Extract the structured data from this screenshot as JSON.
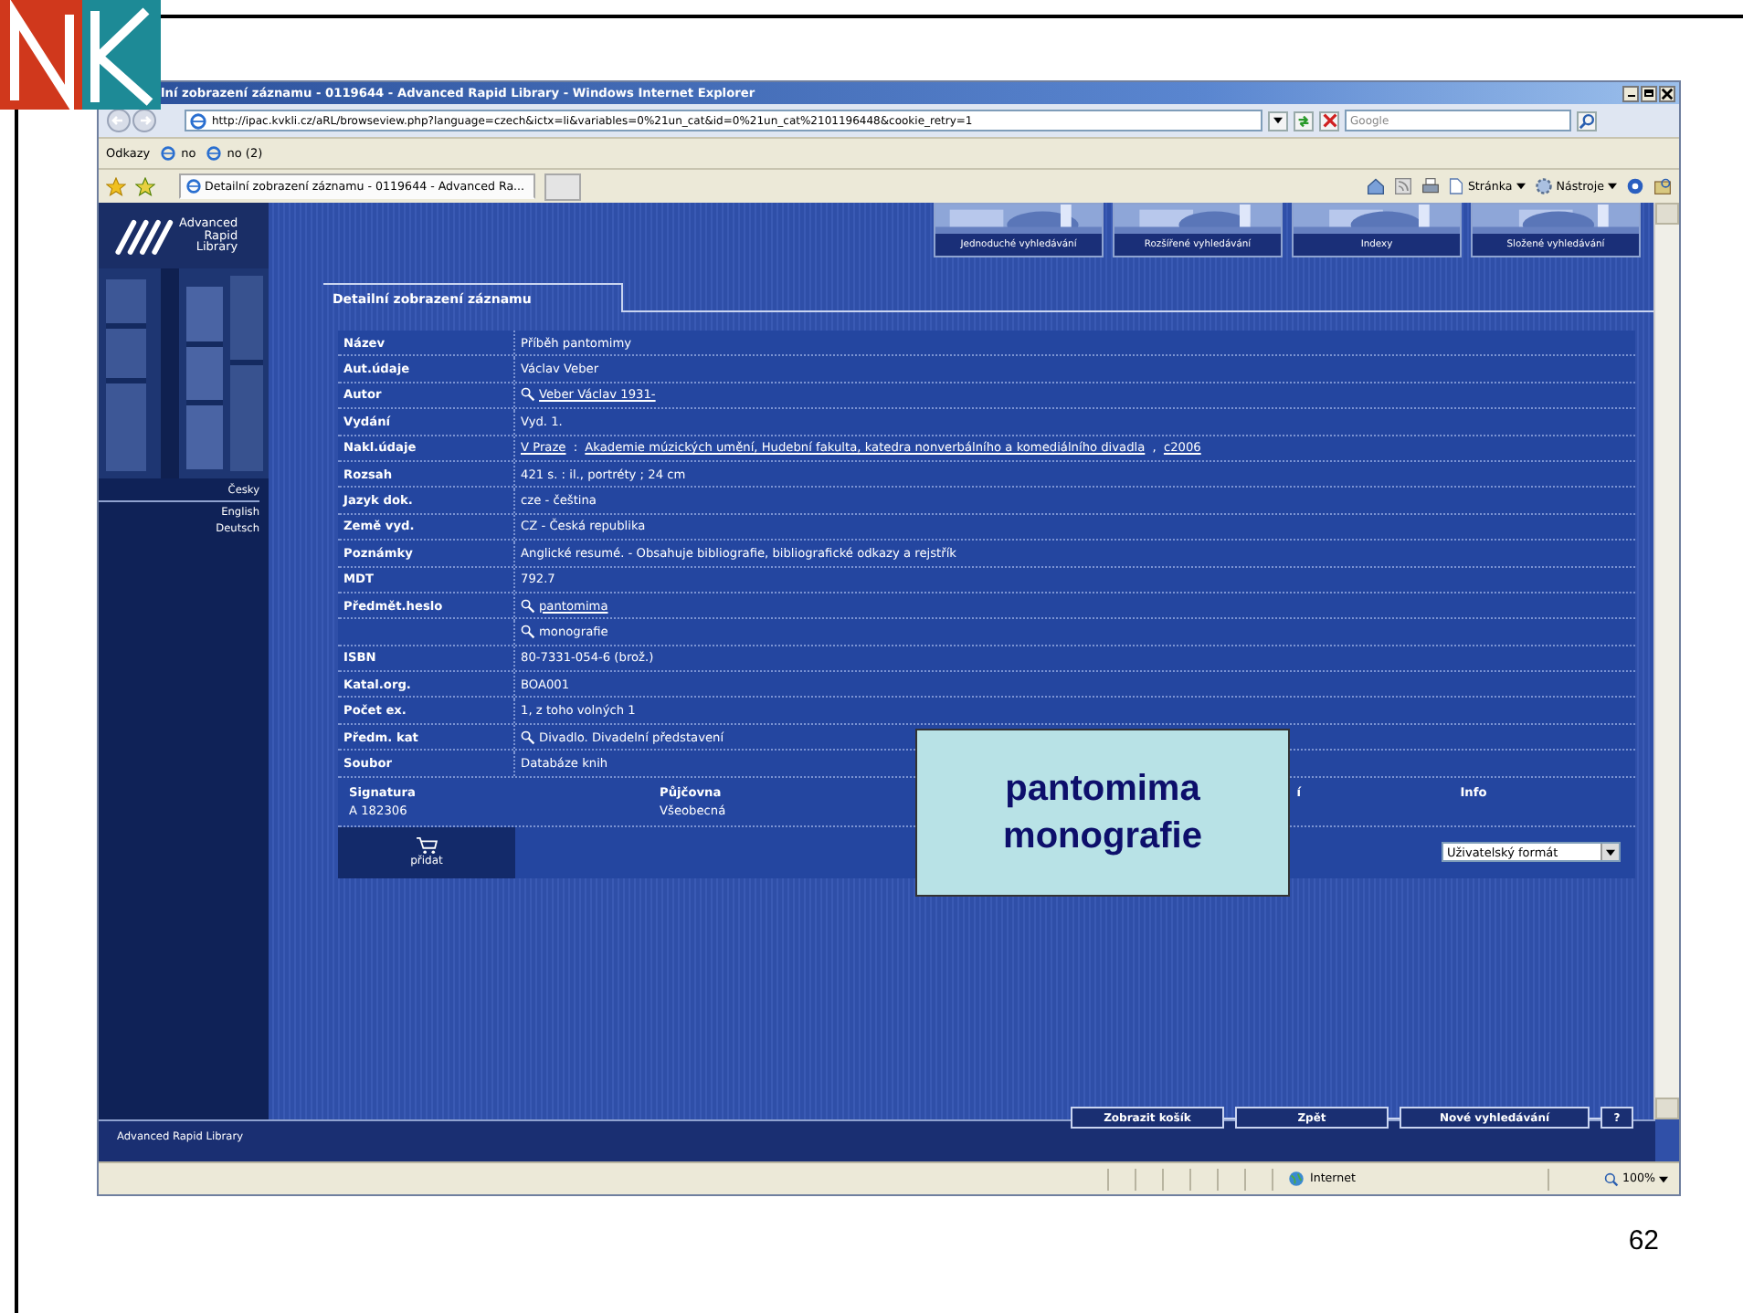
{
  "slide": {
    "page_number": "62"
  },
  "browser": {
    "title": "lní zobrazení záznamu - 0119644 - Advanced Rapid Library - Windows Internet Explorer",
    "address": "http://ipac.kvkli.cz/aRL/browseview.php?language=czech&ictx=li&variables=0%21un_cat&id=0%21un_cat%2101196448&cookie_retry=1",
    "search_placeholder": "Google",
    "links_label": "Odkazy",
    "links": [
      "no",
      "no (2)"
    ],
    "tabs": [
      {
        "label": "Detailní zobrazení záznamu - 0119644 - Advanced Ra...",
        "selected": true
      }
    ],
    "commands": [
      "Stránka",
      "Nástroje"
    ],
    "status": {
      "zone": "Internet",
      "zoom": "100%"
    }
  },
  "page": {
    "logo": [
      "Advanced",
      "Rapid",
      "Library"
    ],
    "languages": [
      "Česky",
      "English",
      "Deutsch"
    ],
    "sidebar_footer": "Advanced Rapid Library",
    "nav": [
      "Jednoduché vyhledávání",
      "Rozšířené vyhledávání",
      "Indexy",
      "Složené vyhledávání"
    ],
    "section_title": "Detailní zobrazení záznamu",
    "record": [
      {
        "label": "Název",
        "parts": [
          {
            "text": "Příběh pantomimy",
            "link": false
          }
        ]
      },
      {
        "label": "Aut.údaje",
        "parts": [
          {
            "text": "Václav Veber",
            "link": false
          }
        ]
      },
      {
        "label": "Autor",
        "search_icon": true,
        "parts": [
          {
            "text": "Veber Václav 1931-",
            "link": true
          }
        ]
      },
      {
        "label": "Vydání",
        "parts": [
          {
            "text": "Vyd. 1.",
            "link": false
          }
        ]
      },
      {
        "label": "Nakl.údaje",
        "parts": [
          {
            "text": "V Praze",
            "link": true
          },
          {
            "text": " : ",
            "link": false
          },
          {
            "text": "Akademie múzických umění, Hudební fakulta, katedra nonverbálního a komediálního divadla",
            "link": true
          },
          {
            "text": " , ",
            "link": false
          },
          {
            "text": "c2006",
            "link": true
          }
        ]
      },
      {
        "label": "Rozsah",
        "parts": [
          {
            "text": "421 s. : il., portréty ; 24 cm",
            "link": false
          }
        ]
      },
      {
        "label": "Jazyk dok.",
        "parts": [
          {
            "text": "cze - čeština",
            "link": false
          }
        ]
      },
      {
        "label": "Země vyd.",
        "parts": [
          {
            "text": "CZ - Česká republika",
            "link": false
          }
        ]
      },
      {
        "label": "Poznámky",
        "parts": [
          {
            "text": "Anglické resumé. - Obsahuje bibliografie, bibliografické odkazy a rejstřík",
            "link": false
          }
        ]
      },
      {
        "label": "MDT",
        "parts": [
          {
            "text": "792.7",
            "link": false
          }
        ]
      },
      {
        "label": "Předmět.heslo",
        "search_icon": true,
        "parts": [
          {
            "text": "pantomima",
            "link": true
          }
        ]
      },
      {
        "search_icon": true,
        "parts": [
          {
            "text": "monografie",
            "link": false
          }
        ]
      },
      {
        "label": "ISBN",
        "parts": [
          {
            "text": "80-7331-054-6 (brož.)",
            "link": false
          }
        ]
      },
      {
        "label": "Katal.org.",
        "parts": [
          {
            "text": "BOA001",
            "link": false
          }
        ]
      },
      {
        "label": "Počet ex.",
        "parts": [
          {
            "text": "1, z toho volných 1",
            "link": false
          }
        ]
      },
      {
        "label": "Předm. kat",
        "search_icon": true,
        "parts": [
          {
            "text": "Divadlo. Divadelní představení",
            "link": false
          }
        ]
      },
      {
        "label": "Soubor",
        "parts": [
          {
            "text": "Databáze knih",
            "link": false
          }
        ]
      }
    ],
    "holdings": {
      "columns": [
        "Signatura",
        "Půjčovna",
        "í",
        "Info"
      ],
      "rows": [
        [
          "A 182306",
          "Všeobecná"
        ]
      ]
    },
    "add_label": "přidat",
    "format": "Uživatelský formát",
    "footer_buttons": [
      "Zobrazit košík",
      "Zpět",
      "Nové vyhledávání",
      "?"
    ]
  },
  "overlay": {
    "lines": [
      "pantomima",
      "monografie"
    ]
  }
}
